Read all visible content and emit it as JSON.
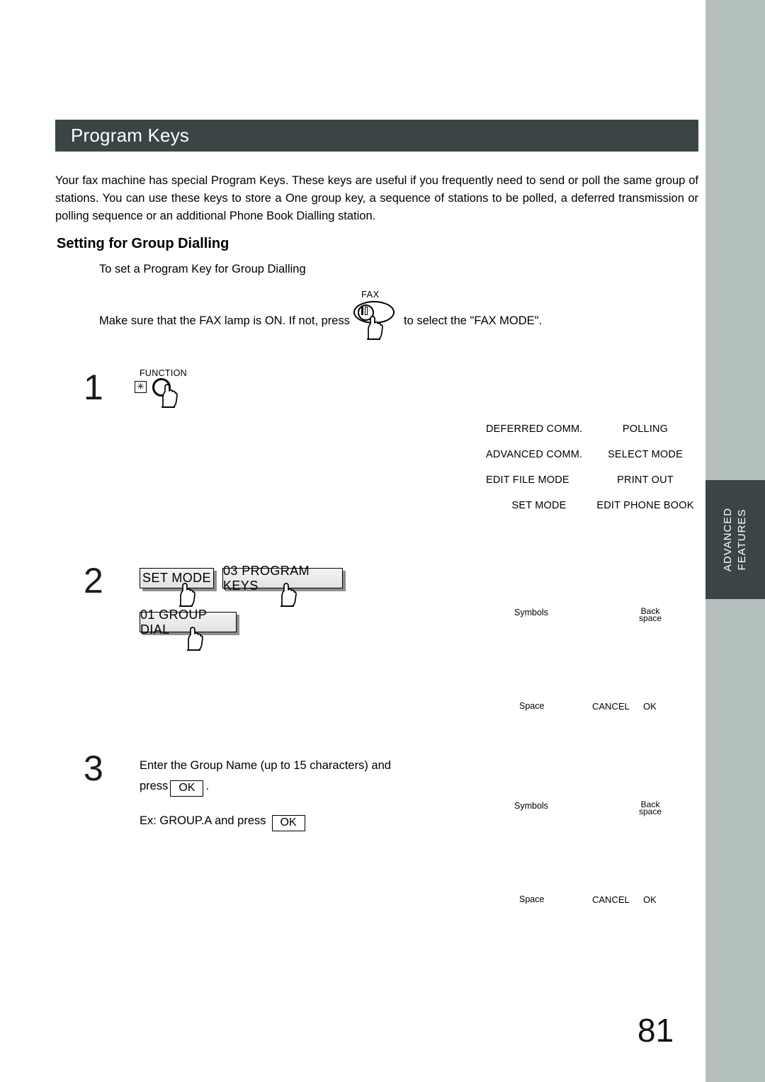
{
  "document": {
    "page_number": "81",
    "side_tab_label": "ADVANCED FEATURES",
    "side_tab_line1": "ADVANCED",
    "side_tab_line2": "FEATURES"
  },
  "section": {
    "title": "Program Keys",
    "intro": "Your fax machine has special Program Keys.  These keys are useful if you frequently need to send or poll the same group of stations.  You can use these keys to store a One group key, a sequence of stations to be polled, a deferred transmission or polling sequence or an additional Phone Book Dialling station.",
    "subheading": "Setting for Group Dialling",
    "subnote": "To set a Program Key for Group Dialling"
  },
  "fax_instruction": {
    "before": "Make sure that the FAX lamp is ON.  If not, press",
    "key_label": "FAX",
    "after": "to select the \"FAX MODE\"."
  },
  "steps": {
    "step1": {
      "number": "1",
      "key_label": "FUNCTION",
      "star_glyph": "✳"
    },
    "step2": {
      "number": "2",
      "keys": [
        {
          "label": "SET MODE"
        },
        {
          "label": "03 PROGRAM KEYS"
        },
        {
          "label": "01 GROUP DIAL"
        }
      ]
    },
    "step3": {
      "number": "3",
      "line1": "Enter the Group Name (up to 15 characters) and",
      "line2_before": "press",
      "line2_after": ".",
      "ok_label": "OK",
      "example_before": "Ex:  GROUP.A and press",
      "example_ok": "OK"
    }
  },
  "lcd_menu": {
    "rows": [
      {
        "left": "DEFERRED COMM.",
        "right": "POLLING"
      },
      {
        "left": "ADVANCED COMM.",
        "right": "SELECT MODE"
      },
      {
        "left": "EDIT FILE MODE",
        "right": "PRINT OUT"
      },
      {
        "left": "SET MODE",
        "right": "EDIT PHONE BOOK"
      }
    ]
  },
  "lcd_entry_panel_1": {
    "symbols": "Symbols",
    "backspace_line1": "Back",
    "backspace_line2": "space",
    "space": "Space",
    "cancel": "CANCEL",
    "ok": "OK"
  },
  "lcd_entry_panel_2": {
    "symbols": "Symbols",
    "backspace_line1": "Back",
    "backspace_line2": "space",
    "space": "Space",
    "cancel": "CANCEL",
    "ok": "OK"
  },
  "colors": {
    "header_bar": "#3b4546",
    "side_strip": "#b3bfbd",
    "tab": "#3b4546",
    "text": "#000000"
  }
}
